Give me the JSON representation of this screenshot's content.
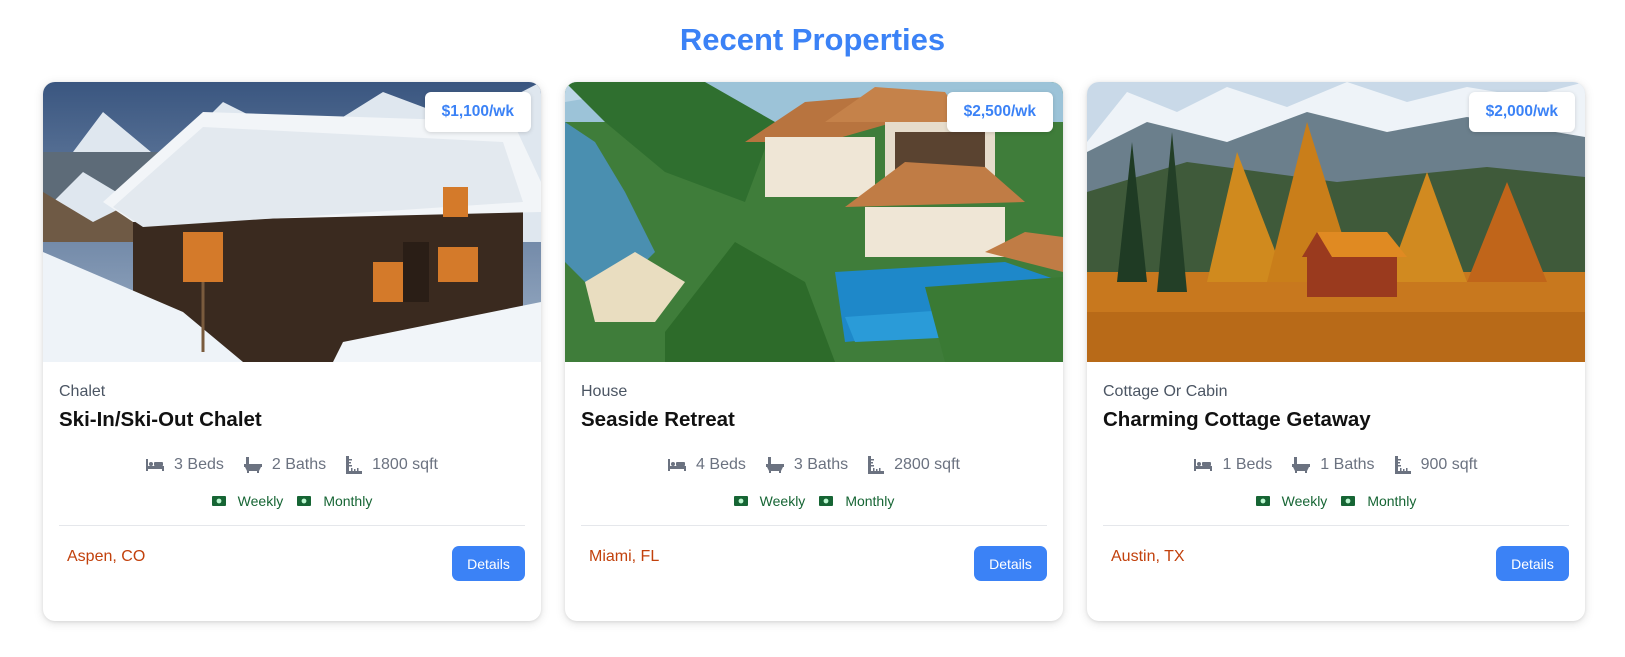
{
  "page": {
    "title": "Recent Properties"
  },
  "properties": [
    {
      "price": "$1,100/wk",
      "type": "Chalet",
      "name": "Ski-In/Ski-Out Chalet",
      "beds": "3 Beds",
      "baths": "2 Baths",
      "area": "1800 sqft",
      "rates": [
        "Weekly",
        "Monthly"
      ],
      "location": "Aspen, CO",
      "button": "Details"
    },
    {
      "price": "$2,500/wk",
      "type": "House",
      "name": "Seaside Retreat",
      "beds": "4 Beds",
      "baths": "3 Baths",
      "area": "2800 sqft",
      "rates": [
        "Weekly",
        "Monthly"
      ],
      "location": "Miami, FL",
      "button": "Details"
    },
    {
      "price": "$2,000/wk",
      "type": "Cottage Or Cabin",
      "name": "Charming Cottage Getaway",
      "beds": "1 Beds",
      "baths": "1 Baths",
      "area": "900 sqft",
      "rates": [
        "Weekly",
        "Monthly"
      ],
      "location": "Austin, TX",
      "button": "Details"
    }
  ],
  "icons": {
    "beds": "bed-icon",
    "baths": "bath-icon",
    "area": "ruler-icon",
    "rate": "money-icon"
  },
  "colors": {
    "accent": "#3b82f6",
    "location": "#c2410c",
    "rate": "#166534"
  }
}
